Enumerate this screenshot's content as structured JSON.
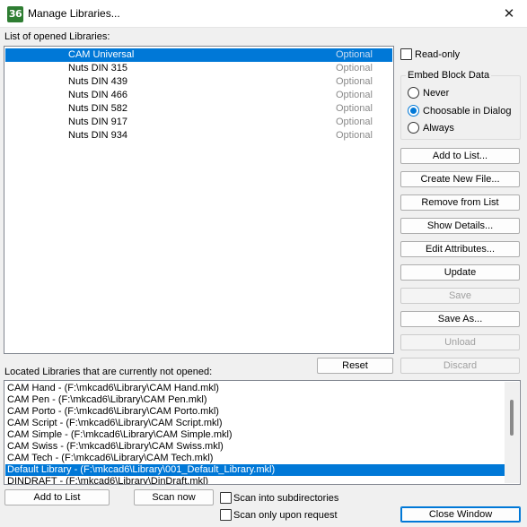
{
  "window": {
    "title": "Manage Libraries...",
    "app_icon_text": "36",
    "close_glyph": "✕"
  },
  "opened": {
    "label": "List of opened Libraries:",
    "items": [
      {
        "name": "CAM Universal",
        "status": "Optional",
        "selected": true
      },
      {
        "name": "Nuts DIN 315",
        "status": "Optional"
      },
      {
        "name": "Nuts DIN 439",
        "status": "Optional"
      },
      {
        "name": "Nuts DIN 466",
        "status": "Optional"
      },
      {
        "name": "Nuts DIN 582",
        "status": "Optional"
      },
      {
        "name": "Nuts DIN 917",
        "status": "Optional"
      },
      {
        "name": "Nuts DIN 934",
        "status": "Optional"
      }
    ]
  },
  "readonly": {
    "label": "Read-only",
    "checked": false
  },
  "embed": {
    "title": "Embed Block Data",
    "options": [
      {
        "label": "Never",
        "selected": false
      },
      {
        "label": "Choosable in Dialog",
        "selected": true
      },
      {
        "label": "Always",
        "selected": false
      }
    ]
  },
  "buttons": {
    "add_to_list": "Add to List...",
    "create_new_file": "Create New File...",
    "remove_from_list": "Remove from List",
    "show_details": "Show Details...",
    "edit_attributes": "Edit Attributes...",
    "update": "Update",
    "save": "Save",
    "save_as": "Save As...",
    "unload": "Unload",
    "discard": "Discard",
    "reset": "Reset",
    "add_to_list_bottom": "Add to List",
    "scan_now": "Scan now",
    "close_window": "Close Window"
  },
  "located": {
    "label": "Located Libraries that are currently not opened:",
    "items": [
      {
        "text": "CAM Hand - (F:\\mkcad6\\Library\\CAM Hand.mkl)"
      },
      {
        "text": "CAM Pen - (F:\\mkcad6\\Library\\CAM Pen.mkl)"
      },
      {
        "text": "CAM Porto - (F:\\mkcad6\\Library\\CAM Porto.mkl)"
      },
      {
        "text": "CAM Script - (F:\\mkcad6\\Library\\CAM Script.mkl)"
      },
      {
        "text": "CAM Simple - (F:\\mkcad6\\Library\\CAM Simple.mkl)"
      },
      {
        "text": "CAM Swiss - (F:\\mkcad6\\Library\\CAM Swiss.mkl)"
      },
      {
        "text": "CAM Tech - (F:\\mkcad6\\Library\\CAM Tech.mkl)"
      },
      {
        "text": "Default Library - (F:\\mkcad6\\Library\\001_Default_Library.mkl)",
        "selected": true
      },
      {
        "text": "DINDRAFT - (F:\\mkcad6\\Library\\DinDraft.mkl)"
      }
    ]
  },
  "scan_subdirs": {
    "label": "Scan into subdirectories",
    "checked": false
  },
  "scan_on_request": {
    "label": "Scan only upon request",
    "checked": false
  },
  "colors": {
    "accent": "#0078d7",
    "app_icon": "#2e7d32"
  }
}
